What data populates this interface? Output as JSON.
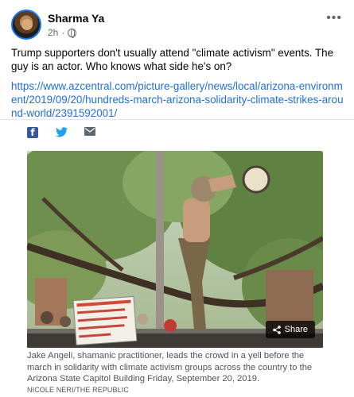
{
  "post": {
    "author": "Sharma Ya",
    "time": "2h",
    "more_icon": "more-horizontal-icon",
    "privacy_icon": "globe-icon",
    "body": "Trump supporters don't usually attend \"climate activism\" events. The guy is an actor. Who knows what side he's on?",
    "link": "https://www.azcentral.com/picture-gallery/news/local/arizona-environment/2019/09/20/hundreds-march-arizona-solidarity-climate-strikes-around-world/2391592001/"
  },
  "share_icons": [
    "facebook-icon",
    "twitter-icon",
    "mail-icon"
  ],
  "photo": {
    "sign_text": "THE FALSE ARE EXPOSED! THE KOOKS ARE MOVING! THIS IS RAGNAROK!!! ITS TIME TO WAKE UP!!! THE SEED ATTN DANIEL",
    "share_label": "Share"
  },
  "caption": "Jake Angeli, shamanic practitioner, leads the crowd in a yell before the march in solidarity with climate activism groups across the country to the Arizona State Capitol Building Friday, September 20, 2019.",
  "credit": "NICOLE NERI/THE REPUBLIC",
  "colors": {
    "link": "#216fdb",
    "facebook": "#365899",
    "twitter": "#1da1f2"
  }
}
